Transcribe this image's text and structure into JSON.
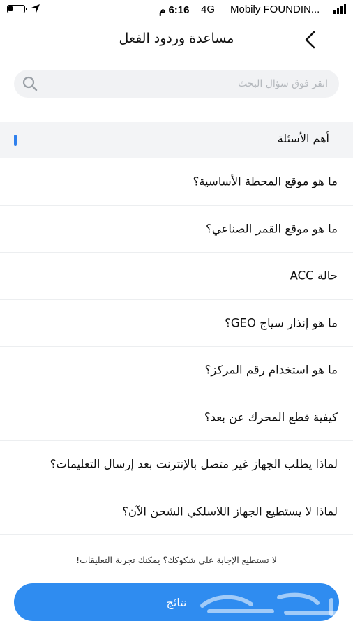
{
  "status_bar": {
    "time": "6:16 م",
    "network": "4G",
    "carrier": "Mobily FOUNDIN..."
  },
  "header": {
    "title": "مساعدة وردود الفعل",
    "back_icon": "chevron-left-icon"
  },
  "search": {
    "placeholder": "انقر فوق سؤال البحث",
    "value": "",
    "icon": "search-icon"
  },
  "section": {
    "title": "أهم الأسئلة",
    "accent_color": "#2f80ed"
  },
  "faq_items": [
    "ما هو موقع المحطة الأساسية؟",
    "ما هو موقع القمر الصناعي؟",
    "حالة ACC",
    "ما هو إنذار سياج GEO؟",
    "ما هو استخدام رقم المركز؟",
    "كيفية قطع المحرك عن بعد؟",
    "لماذا يطلب الجهاز غير متصل بالإنترنت بعد إرسال التعليمات؟",
    "لماذا لا يستطيع الجهاز اللاسلكي الشحن الآن؟"
  ],
  "footer": {
    "note": "لا تستطيع الإجابة على شكوكك؟ يمكنك تجربة التعليقات!",
    "button_label": "نتائج",
    "button_color": "#2f8cf0"
  },
  "watermark": "حراج"
}
